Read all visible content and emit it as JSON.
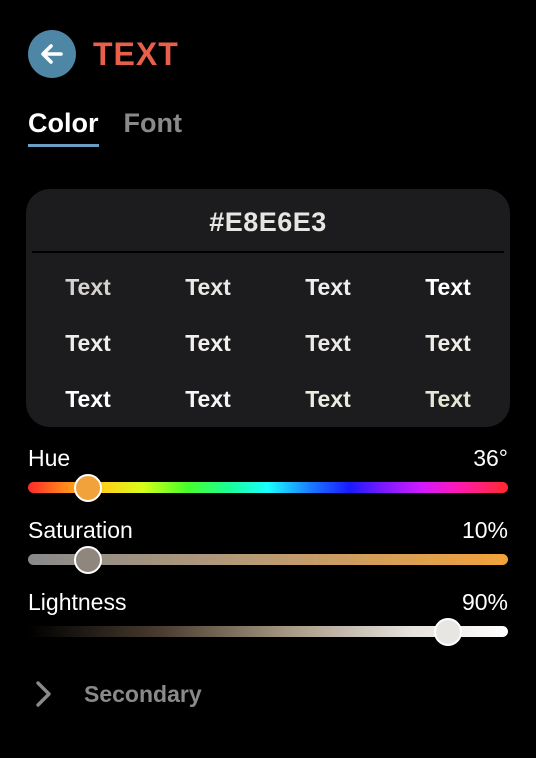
{
  "header": {
    "title": "TEXT",
    "back_icon": "arrow-left-icon",
    "accent_color": "#e8604a",
    "back_button_color": "#4e86a6"
  },
  "tabs": [
    {
      "label": "Color",
      "active": true
    },
    {
      "label": "Font",
      "active": false
    }
  ],
  "preview": {
    "hex": "#E8E6E3",
    "samples": [
      [
        {
          "label": "Text",
          "color": "#d6d2cf"
        },
        {
          "label": "Text",
          "color": "#ebe9e6"
        },
        {
          "label": "Text",
          "color": "#eeeeee"
        },
        {
          "label": "Text",
          "color": "#ffffff"
        }
      ],
      [
        {
          "label": "Text",
          "color": "#f0eeeb"
        },
        {
          "label": "Text",
          "color": "#f3f1ee"
        },
        {
          "label": "Text",
          "color": "#eceae6"
        },
        {
          "label": "Text",
          "color": "#efede6"
        }
      ],
      [
        {
          "label": "Text",
          "color": "#ffffff"
        },
        {
          "label": "Text",
          "color": "#f6f5f3"
        },
        {
          "label": "Text",
          "color": "#ecebe0"
        },
        {
          "label": "Text",
          "color": "#e2e6d2"
        }
      ]
    ]
  },
  "sliders": {
    "hue": {
      "label": "Hue",
      "value_text": "36°",
      "position": 0.125,
      "thumb_color": "#f2a23a"
    },
    "saturation": {
      "label": "Saturation",
      "value_text": "10%",
      "position": 0.125,
      "thumb_color": "#8f877d"
    },
    "lightness": {
      "label": "Lightness",
      "value_text": "90%",
      "position": 0.875,
      "thumb_color": "#e8e6e3"
    }
  },
  "secondary": {
    "label": "Secondary",
    "icon": "chevron-right-icon"
  }
}
